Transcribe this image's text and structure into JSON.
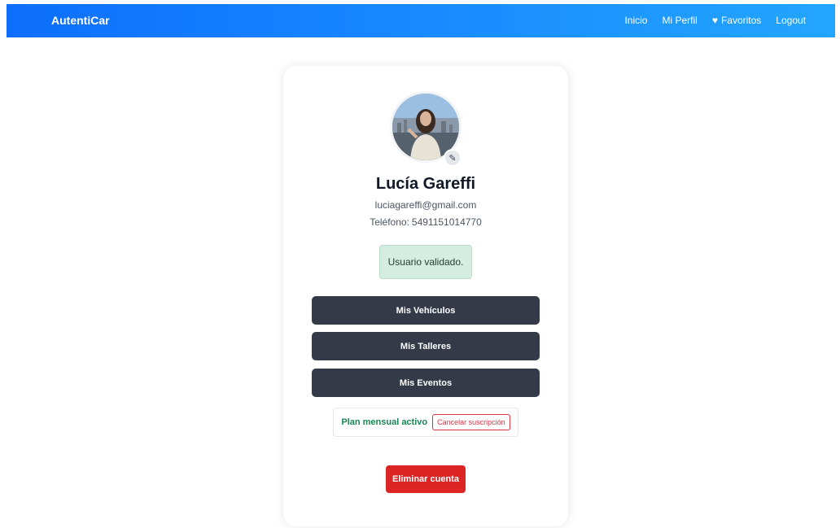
{
  "nav": {
    "brand": "AutentiCar",
    "links": {
      "inicio": "Inicio",
      "mi_perfil": "Mi Perfil",
      "favoritos": "Favoritos",
      "logout": "Logout"
    },
    "favoritos_icon": "heart-icon"
  },
  "profile": {
    "name": "Lucía Gareffi",
    "email": "luciagareffi@gmail.com",
    "phone_label": "Teléfono:",
    "phone": "5491151014770",
    "edit_icon": "pencil-icon",
    "validated_text": "Usuario validado."
  },
  "actions": {
    "vehiculos": "Mis Vehículos",
    "talleres": "Mis Talleres",
    "eventos": "Mis Eventos"
  },
  "subscription": {
    "plan_text": "Plan mensual activo",
    "cancel_label": "Cancelar suscripción"
  },
  "danger": {
    "delete_label": "Eliminar cuenta"
  },
  "colors": {
    "nav_start": "#0d6efd",
    "nav_end": "#22a6ff",
    "dark_button": "#343a48",
    "success": "#198754",
    "danger": "#dc2626",
    "validated_bg": "#d4ede0"
  }
}
